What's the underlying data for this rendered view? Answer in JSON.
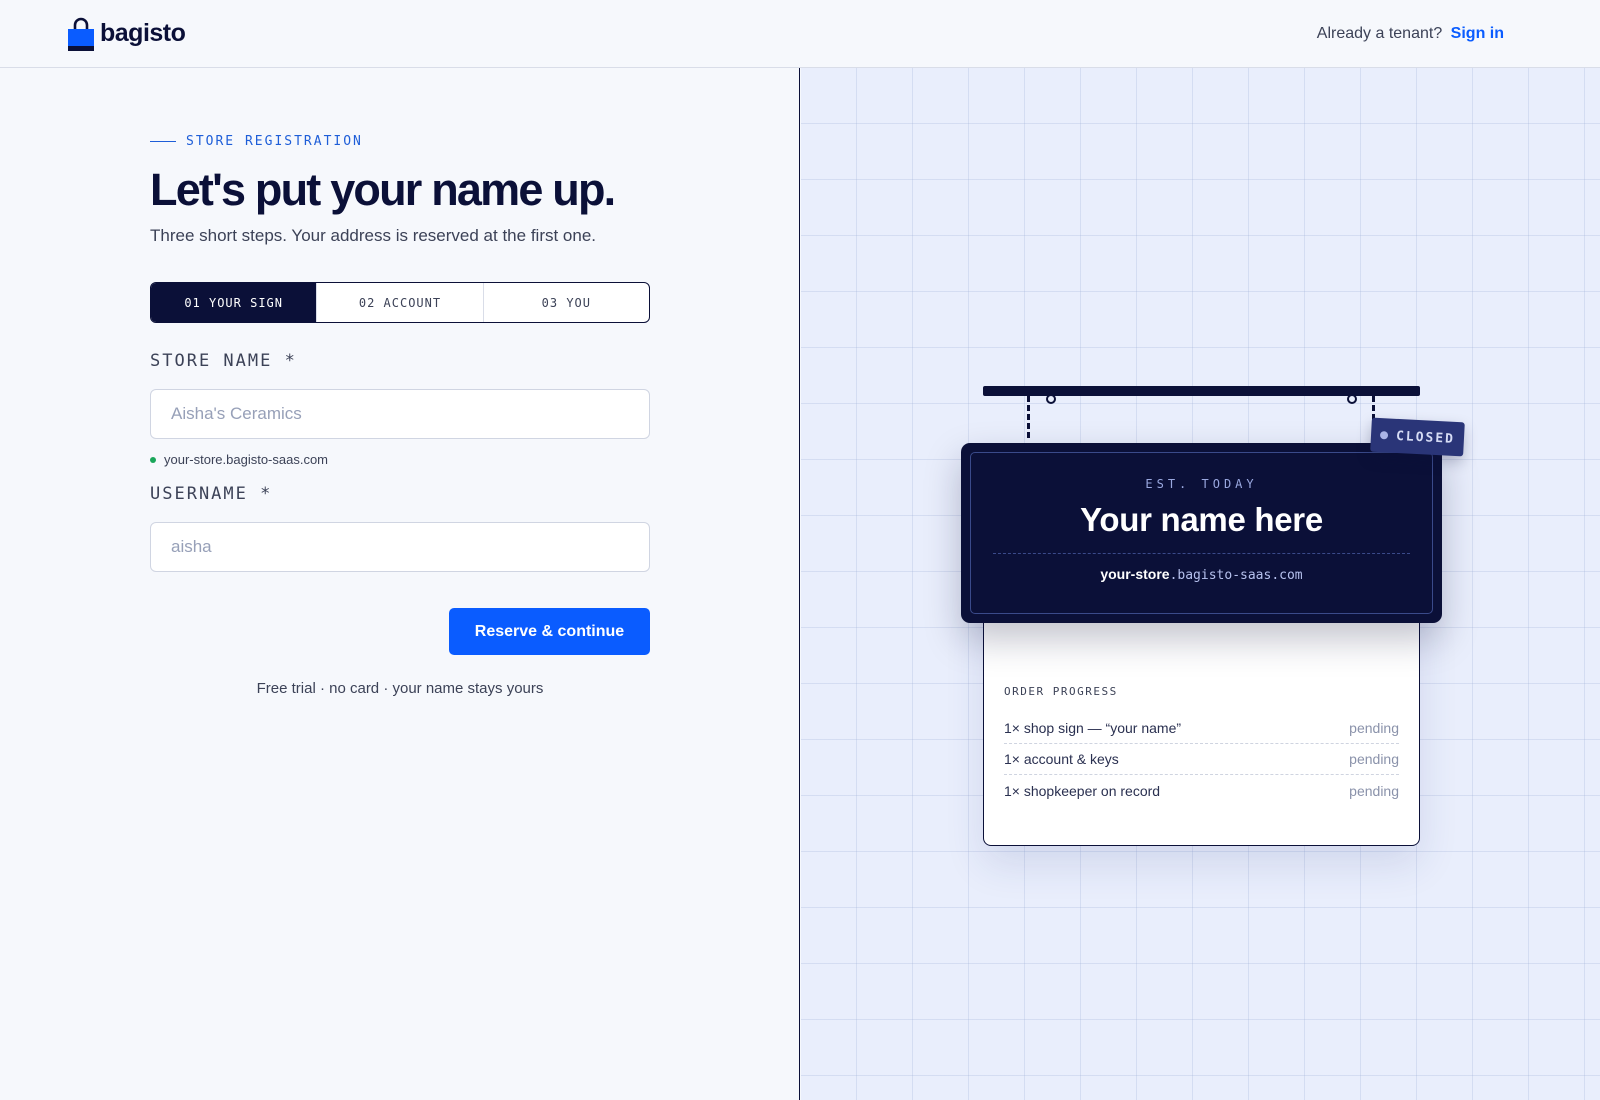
{
  "header": {
    "brand": "bagisto",
    "prompt": "Already a tenant?",
    "sign_in": "Sign in"
  },
  "form": {
    "kicker": "STORE REGISTRATION",
    "title": "Let's put your name up.",
    "subtitle": "Three short steps. Your address is reserved at the first one.",
    "steps": [
      {
        "label": "01 YOUR SIGN",
        "active": true
      },
      {
        "label": "02 ACCOUNT",
        "active": false
      },
      {
        "label": "03 YOU",
        "active": false
      }
    ],
    "store_name": {
      "label": "STORE NAME *",
      "placeholder": "Aisha's Ceramics",
      "value": ""
    },
    "domain_hint": "your-store.bagisto-saas.com",
    "username": {
      "label": "USERNAME *",
      "placeholder": "aisha",
      "value": ""
    },
    "submit": "Reserve & continue",
    "footnote": "Free trial · no card · your name stays yours"
  },
  "preview": {
    "closed_tag": "CLOSED",
    "est": "EST. TODAY",
    "name": "Your name here",
    "subdomain": "your-store",
    "domain_rest": ".bagisto-saas.com",
    "order_title": "ORDER PROGRESS",
    "orders": [
      {
        "item": "1× shop sign — “your name”",
        "status": "pending"
      },
      {
        "item": "1× account & keys",
        "status": "pending"
      },
      {
        "item": "1× shopkeeper on record",
        "status": "pending"
      }
    ]
  },
  "colors": {
    "accent": "#0a5cff",
    "navy": "#0b1038",
    "success": "#1aa65a"
  }
}
